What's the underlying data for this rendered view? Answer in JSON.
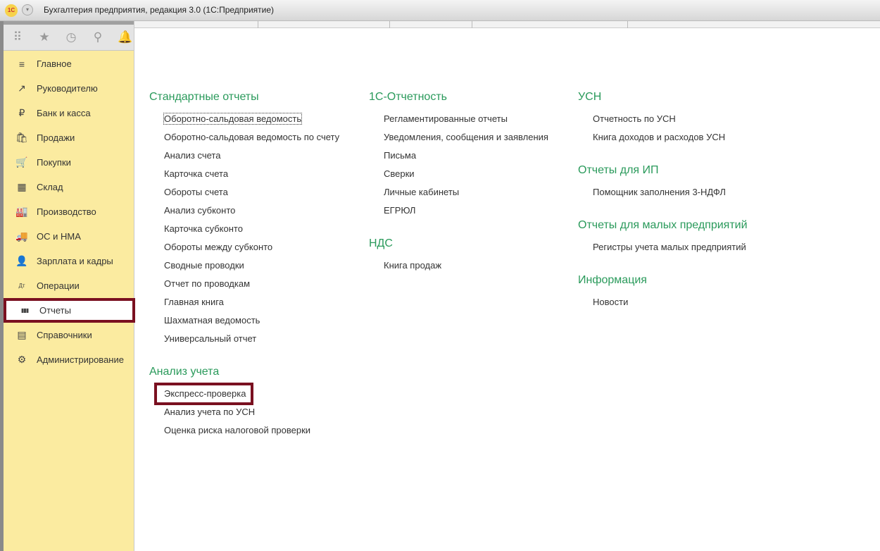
{
  "window": {
    "title": "Бухгалтерия предприятия, редакция 3.0  (1С:Предприятие)",
    "logo": "1С"
  },
  "toolbar": {
    "icons": [
      "apps-grid-icon",
      "star-icon",
      "history-icon",
      "search-icon",
      "bell-icon"
    ]
  },
  "sidebar": {
    "items": [
      {
        "label": "Главное",
        "icon": "≡"
      },
      {
        "label": "Руководителю",
        "icon": "↗"
      },
      {
        "label": "Банк и касса",
        "icon": "₽"
      },
      {
        "label": "Продажи",
        "icon": "🛍"
      },
      {
        "label": "Покупки",
        "icon": "🛒"
      },
      {
        "label": "Склад",
        "icon": "▦"
      },
      {
        "label": "Производство",
        "icon": "🏭"
      },
      {
        "label": "ОС и НМА",
        "icon": "🚚"
      },
      {
        "label": "Зарплата и кадры",
        "icon": "👤"
      },
      {
        "label": "Операции",
        "icon": "Дт"
      },
      {
        "label": "Отчеты",
        "icon": "▮▮▮"
      },
      {
        "label": "Справочники",
        "icon": "▤"
      },
      {
        "label": "Администрирование",
        "icon": "⚙"
      }
    ],
    "active": "Отчеты"
  },
  "sections": [
    {
      "title": "Стандартные отчеты",
      "items": [
        "Оборотно-сальдовая ведомость",
        "Оборотно-сальдовая ведомость по счету",
        "Анализ счета",
        "Карточка счета",
        "Обороты счета",
        "Анализ субконто",
        "Карточка субконто",
        "Обороты между субконто",
        "Сводные проводки",
        "Отчет по проводкам",
        "Главная книга",
        "Шахматная ведомость",
        "Универсальный отчет"
      ]
    },
    {
      "title": "Анализ учета",
      "items": [
        "Экспресс-проверка",
        "Анализ учета по УСН",
        "Оценка риска налоговой проверки"
      ]
    },
    {
      "title": "1С-Отчетность",
      "items": [
        "Регламентированные отчеты",
        "Уведомления, сообщения и заявления",
        "Письма",
        "Сверки",
        "Личные кабинеты",
        "ЕГРЮЛ"
      ]
    },
    {
      "title": "НДС",
      "items": [
        "Книга продаж"
      ]
    },
    {
      "title": "УСН",
      "items": [
        "Отчетность по УСН",
        "Книга доходов и расходов УСН"
      ]
    },
    {
      "title": "Отчеты для ИП",
      "items": [
        "Помощник заполнения 3-НДФЛ"
      ]
    },
    {
      "title": "Отчеты для малых предприятий",
      "items": [
        "Регистры учета малых предприятий"
      ]
    },
    {
      "title": "Информация",
      "items": [
        "Новости"
      ]
    }
  ]
}
